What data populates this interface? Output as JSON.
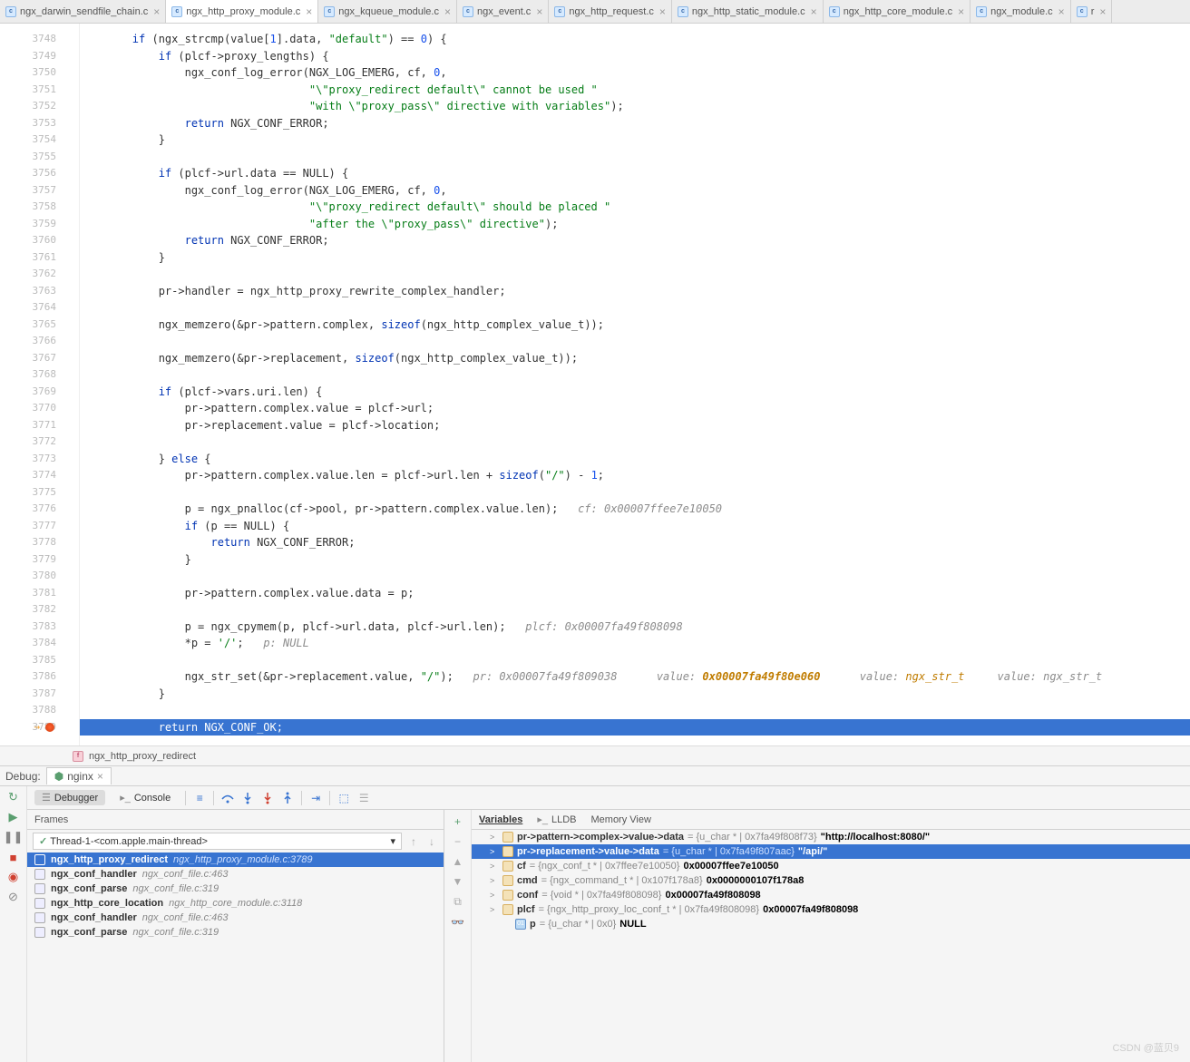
{
  "tabs": [
    {
      "name": "ngx_darwin_sendfile_chain.c"
    },
    {
      "name": "ngx_http_proxy_module.c",
      "active": true
    },
    {
      "name": "ngx_kqueue_module.c"
    },
    {
      "name": "ngx_event.c"
    },
    {
      "name": "ngx_http_request.c"
    },
    {
      "name": "ngx_http_static_module.c"
    },
    {
      "name": "ngx_http_core_module.c"
    },
    {
      "name": "ngx_module.c"
    },
    {
      "name": "r"
    }
  ],
  "code_start_line": 3748,
  "exec_line": 3789,
  "code_lines": [
    [
      [
        "        "
      ],
      [
        "if",
        "kw"
      ],
      [
        " (ngx_strcmp(value["
      ],
      [
        "1",
        "num"
      ],
      [
        "].data, "
      ],
      [
        "\"default\"",
        "str"
      ],
      [
        ") == "
      ],
      [
        "0",
        "num"
      ],
      [
        ") {"
      ]
    ],
    [
      [
        "            "
      ],
      [
        "if",
        "kw"
      ],
      [
        " (plcf->proxy_lengths) {"
      ]
    ],
    [
      [
        "                ngx_conf_log_error(NGX_LOG_EMERG, cf, "
      ],
      [
        "0",
        "num"
      ],
      [
        ","
      ]
    ],
    [
      [
        "                                   "
      ],
      [
        "\"\\\"proxy_redirect default\\\" cannot be used \"",
        "str"
      ]
    ],
    [
      [
        "                                   "
      ],
      [
        "\"with \\\"proxy_pass\\\" directive with variables\"",
        "str"
      ],
      [
        ");"
      ]
    ],
    [
      [
        "                "
      ],
      [
        "return",
        "kw"
      ],
      [
        " NGX_CONF_ERROR;"
      ]
    ],
    [
      [
        "            }"
      ]
    ],
    [
      [
        ""
      ]
    ],
    [
      [
        "            "
      ],
      [
        "if",
        "kw"
      ],
      [
        " (plcf->url.data == NULL) {"
      ]
    ],
    [
      [
        "                ngx_conf_log_error(NGX_LOG_EMERG, cf, "
      ],
      [
        "0",
        "num"
      ],
      [
        ","
      ]
    ],
    [
      [
        "                                   "
      ],
      [
        "\"\\\"proxy_redirect default\\\" should be placed \"",
        "str"
      ]
    ],
    [
      [
        "                                   "
      ],
      [
        "\"after the \\\"proxy_pass\\\" directive\"",
        "str"
      ],
      [
        ");"
      ]
    ],
    [
      [
        "                "
      ],
      [
        "return",
        "kw"
      ],
      [
        " NGX_CONF_ERROR;"
      ]
    ],
    [
      [
        "            }"
      ]
    ],
    [
      [
        ""
      ]
    ],
    [
      [
        "            pr->handler = ngx_http_proxy_rewrite_complex_handler;"
      ]
    ],
    [
      [
        ""
      ]
    ],
    [
      [
        "            ngx_memzero(&pr->pattern.complex, "
      ],
      [
        "sizeof",
        "kw"
      ],
      [
        "(ngx_http_complex_value_t));"
      ]
    ],
    [
      [
        ""
      ]
    ],
    [
      [
        "            ngx_memzero(&pr->replacement, "
      ],
      [
        "sizeof",
        "kw"
      ],
      [
        "(ngx_http_complex_value_t));"
      ]
    ],
    [
      [
        ""
      ]
    ],
    [
      [
        "            "
      ],
      [
        "if",
        "kw"
      ],
      [
        " (plcf->vars.uri.len) {"
      ]
    ],
    [
      [
        "                pr->pattern.complex.value = plcf->url;"
      ]
    ],
    [
      [
        "                pr->replacement.value = plcf->location;"
      ]
    ],
    [
      [
        ""
      ]
    ],
    [
      [
        "            } "
      ],
      [
        "else",
        "kw"
      ],
      [
        " {"
      ]
    ],
    [
      [
        "                pr->pattern.complex.value.len = plcf->url.len + "
      ],
      [
        "sizeof",
        "kw"
      ],
      [
        "("
      ],
      [
        "\"/\"",
        "str"
      ],
      [
        ") - "
      ],
      [
        "1",
        "num"
      ],
      [
        ";"
      ]
    ],
    [
      [
        ""
      ]
    ],
    [
      [
        "                p = ngx_pnalloc(cf->pool, pr->pattern.complex.value.len);   "
      ],
      [
        "cf: 0x00007ffee7e10050",
        "cm"
      ]
    ],
    [
      [
        "                "
      ],
      [
        "if",
        "kw"
      ],
      [
        " (p == NULL) {"
      ]
    ],
    [
      [
        "                    "
      ],
      [
        "return",
        "kw"
      ],
      [
        " NGX_CONF_ERROR;"
      ]
    ],
    [
      [
        "                }"
      ]
    ],
    [
      [
        ""
      ]
    ],
    [
      [
        "                pr->pattern.complex.value.data = p;"
      ]
    ],
    [
      [
        ""
      ]
    ],
    [
      [
        "                p = ngx_cpymem(p, plcf->url.data, plcf->url.len);   "
      ],
      [
        "plcf: 0x00007fa49f808098",
        "cm"
      ]
    ],
    [
      [
        "                *p = "
      ],
      [
        "'/'",
        "str"
      ],
      [
        ";   "
      ],
      [
        "p: NULL",
        "cm"
      ]
    ],
    [
      [
        ""
      ]
    ],
    [
      [
        "                ngx_str_set(&pr->replacement.value, "
      ],
      [
        "\"/\"",
        "str"
      ],
      [
        ");   "
      ],
      [
        "pr: 0x00007fa49f809038",
        "cm"
      ],
      [
        "      "
      ],
      [
        "value: ",
        "cm"
      ],
      [
        "0x00007fa49f80e060",
        "cm3"
      ],
      [
        "      "
      ],
      [
        "value: ",
        "cm"
      ],
      [
        "ngx_str_t",
        "cm2"
      ],
      [
        "     "
      ],
      [
        "value: ngx_str_t",
        "cm"
      ]
    ],
    [
      [
        "            }"
      ]
    ],
    [
      [
        ""
      ]
    ],
    [
      [
        "            "
      ],
      [
        "return",
        "kw"
      ],
      [
        " NGX_CONF_OK;"
      ]
    ]
  ],
  "breadcrumb_fn": "ngx_http_proxy_redirect",
  "debug_label": "Debug:",
  "debug_target": "nginx",
  "dbg_tabs": {
    "debugger": "Debugger",
    "console": "Console"
  },
  "frames_label": "Frames",
  "thread_label": "Thread-1-<com.apple.main-thread>",
  "frames": [
    {
      "fn": "ngx_http_proxy_redirect",
      "loc": "ngx_http_proxy_module.c:3789",
      "sel": true
    },
    {
      "fn": "ngx_conf_handler",
      "loc": "ngx_conf_file.c:463"
    },
    {
      "fn": "ngx_conf_parse",
      "loc": "ngx_conf_file.c:319"
    },
    {
      "fn": "ngx_http_core_location",
      "loc": "ngx_http_core_module.c:3118"
    },
    {
      "fn": "ngx_conf_handler",
      "loc": "ngx_conf_file.c:463"
    },
    {
      "fn": "ngx_conf_parse",
      "loc": "ngx_conf_file.c:319"
    }
  ],
  "vars_tabs": {
    "variables": "Variables",
    "lldb": "LLDB",
    "memory": "Memory View"
  },
  "vars": [
    {
      "indent": 1,
      "chev": ">",
      "name": "pr->pattern->complex->value->data",
      "type": "= {u_char * | 0x7fa49f808f73}",
      "val": "\"http://localhost:8080/\""
    },
    {
      "indent": 1,
      "chev": ">",
      "name": "pr->replacement->value->data",
      "type": "= {u_char * | 0x7fa49f807aac}",
      "val": "\"/api/\"",
      "sel": true
    },
    {
      "indent": 1,
      "chev": ">",
      "name": "cf",
      "type": "= {ngx_conf_t * | 0x7ffee7e10050}",
      "val": "0x00007ffee7e10050"
    },
    {
      "indent": 1,
      "chev": ">",
      "name": "cmd",
      "type": "= {ngx_command_t * | 0x107f178a8}",
      "val": "0x0000000107f178a8"
    },
    {
      "indent": 1,
      "chev": ">",
      "name": "conf",
      "type": "= {void * | 0x7fa49f808098}",
      "val": "0x00007fa49f808098"
    },
    {
      "indent": 1,
      "chev": ">",
      "name": "plcf",
      "type": "= {ngx_http_proxy_loc_conf_t * | 0x7fa49f808098}",
      "val": "0x00007fa49f808098"
    },
    {
      "indent": 2,
      "chev": "",
      "icon2": "01",
      "name": "p",
      "type": "= {u_char * | 0x0}",
      "val": "NULL"
    }
  ],
  "watermark": "CSDN @蓝贝9"
}
